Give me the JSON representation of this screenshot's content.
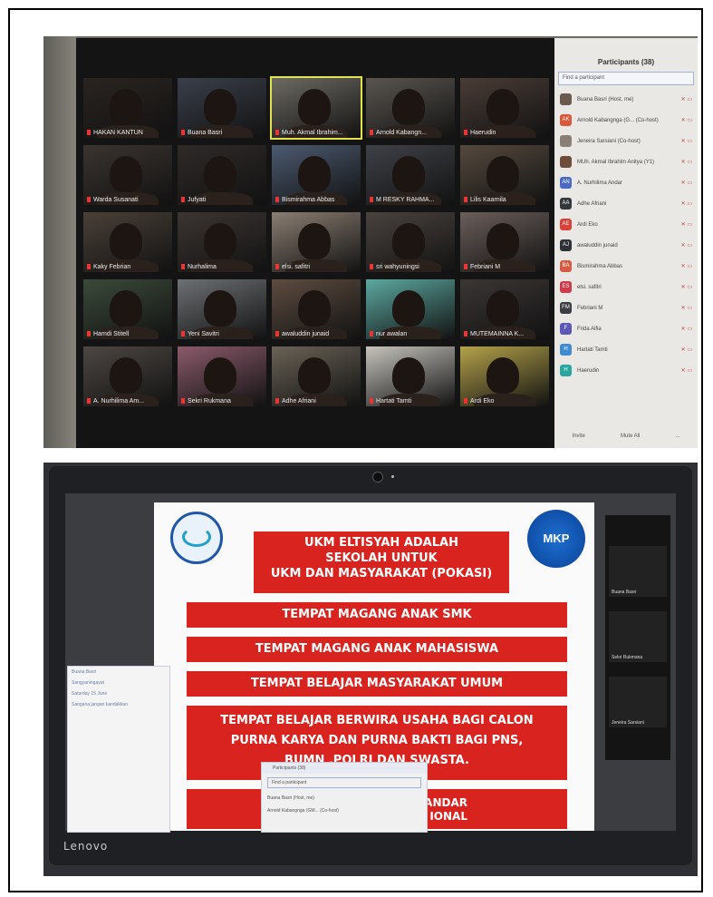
{
  "participants_panel": {
    "title": "Participants (38)",
    "search_placeholder": "Find a participant",
    "rows": [
      {
        "name": "Buana Basri (Host, me)",
        "initials": "",
        "color": "#6a5a50"
      },
      {
        "name": "Arnold Kabangnga (G... (Co-host)",
        "initials": "AK",
        "color": "#d9583b"
      },
      {
        "name": "Jeneira Sarsiani (Co-host)",
        "initials": "",
        "color": "#8a7f76"
      },
      {
        "name": "MUh. Akmal Ibrahim Anitya (Y1)",
        "initials": "",
        "color": "#6e4d3a"
      },
      {
        "name": "A. Nurhilima Andar",
        "initials": "AN",
        "color": "#4a6ac2"
      },
      {
        "name": "Adhe Afriani",
        "initials": "AA",
        "color": "#33363a"
      },
      {
        "name": "Ardi Eko",
        "initials": "AE",
        "color": "#d8423a"
      },
      {
        "name": "awaluddin junaid",
        "initials": "AJ",
        "color": "#2f3137"
      },
      {
        "name": "Bismirahma Abbas",
        "initials": "BA",
        "color": "#d75b44"
      },
      {
        "name": "elsi. safitri",
        "initials": "ES",
        "color": "#d03a4a"
      },
      {
        "name": "Febriani M",
        "initials": "FM",
        "color": "#3a3d42"
      },
      {
        "name": "Frida Alfia",
        "initials": "F",
        "color": "#5d58b5"
      },
      {
        "name": "Hartati Tamti",
        "initials": "H",
        "color": "#3f8bd1"
      },
      {
        "name": "Haerudin",
        "initials": "H",
        "color": "#2aa6a0"
      }
    ],
    "footer": [
      "Invite",
      "Mute All",
      "..."
    ]
  },
  "gallery": [
    {
      "name": "HAKAN KANTUN"
    },
    {
      "name": "Buana Basri"
    },
    {
      "name": "Muh. Akmal Ibrahim..."
    },
    {
      "name": "Arnold Kabangn..."
    },
    {
      "name": "Haerudin"
    },
    {
      "name": "Warda Susanati"
    },
    {
      "name": "Jufyati"
    },
    {
      "name": "Bismirahma Abbas"
    },
    {
      "name": "M RESKY RAHMA..."
    },
    {
      "name": "Lilis Kaarnila"
    },
    {
      "name": "Kaky Febrian"
    },
    {
      "name": "Nurhalima"
    },
    {
      "name": "elsi. safitri"
    },
    {
      "name": "sri wahyuningsi"
    },
    {
      "name": "Febriani M"
    },
    {
      "name": "Hamdi Stitell"
    },
    {
      "name": "Yeni Savitri"
    },
    {
      "name": "awaluddin junaid"
    },
    {
      "name": "nur awalan"
    },
    {
      "name": "MUTEMAINNA K..."
    },
    {
      "name": "A. Nurhilima Am..."
    },
    {
      "name": "Sekri Rukmana"
    },
    {
      "name": "Adhe Afriani"
    },
    {
      "name": "Hartati Tamti"
    },
    {
      "name": "Ardi Eko"
    }
  ],
  "slide": {
    "header": [
      "UKM ELTISYAH ADALAH",
      "SEKOLAH  UNTUK",
      "UKM DAN MASYARAKAT (POKASI)"
    ],
    "box1": "TEMPAT MAGANG ANAK SMK",
    "box2": "TEMPAT MAGANG ANAK  MAHASISWA",
    "box3": "TEMPAT BELAJAR MASYARAKAT UMUM",
    "box4": [
      "TEMPAT BELAJAR BERWIRA USAHA BAGI CALON",
      "PURNA KARYA  DAN PURNA BAKTI BAGI PNS,",
      "BUMN ,POLRI DAN SWASTA."
    ],
    "box5": [
      "ANDAR",
      "IONAL"
    ],
    "logo_right": "MKP"
  },
  "strip": [
    {
      "name": "Buana Basri"
    },
    {
      "name": "Sekri Rukmana"
    },
    {
      "name": "Jeneira Sarsiani"
    }
  ],
  "chat_dialog": [
    "Buana Basri",
    "Sangyaningayat",
    "Saturday 15 June",
    "Sangana jangan kandakkan"
  ],
  "mini_participants": {
    "title": "Participants (38)",
    "search": "Find a participant",
    "rows": [
      "Buana Basri (Host, me)",
      "Arnold Kabangnga (GM... (Co-host)"
    ]
  },
  "brand": "Lenovo"
}
